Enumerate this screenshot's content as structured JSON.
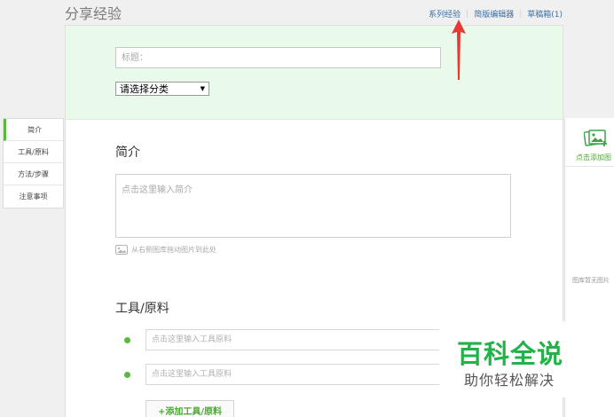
{
  "header": {
    "page_title": "分享经验",
    "links": [
      "系列经验",
      "简版编辑器",
      "草稿箱(1)"
    ]
  },
  "form": {
    "title_placeholder": "标题：",
    "category_value": "请选择分类"
  },
  "intro": {
    "heading": "简介",
    "placeholder": "点击这里输入简介",
    "drag_hint": "从右侧图库拖动图片到此处"
  },
  "tools": {
    "heading": "工具/原料",
    "input_placeholder": "点击这里输入工具原料",
    "add_label": "+添加工具/原料"
  },
  "side_nav": {
    "items": [
      "简介",
      "工具/原料",
      "方法/步骤",
      "注意事项"
    ]
  },
  "gallery": {
    "add_label": "点击添加图",
    "empty_label": "图库暂无图片"
  },
  "watermark": {
    "main": "百科全说",
    "sub": "助你轻松解决"
  },
  "colors": {
    "accent_green": "#5aba3e",
    "annotation_red": "#e53935",
    "link_blue": "#3b6ea5"
  }
}
